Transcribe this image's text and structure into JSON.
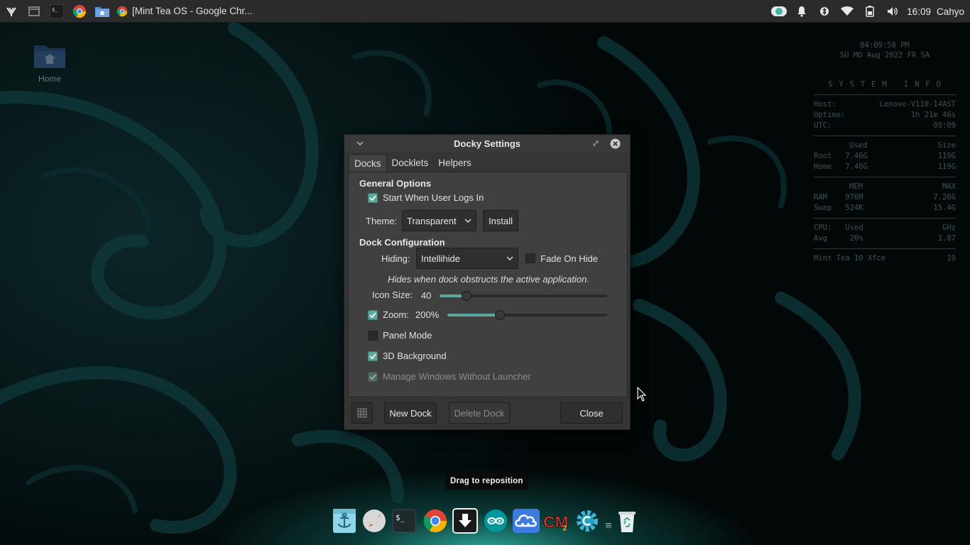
{
  "top_panel": {
    "window_title": "[Mint Tea OS - Google Chr...",
    "clock": "16:09",
    "user": "Cahyo",
    "launcher_icons": [
      "whisker-menu-icon",
      "show-desktop-icon",
      "terminal-icon",
      "chrome-icon",
      "home-folder-icon"
    ],
    "tray_icons": [
      "toggle-icon",
      "notification-bell-icon",
      "bluetooth-icon",
      "wifi-icon",
      "battery-icon",
      "volume-icon"
    ]
  },
  "desktop": {
    "home_label": "Home"
  },
  "conky": {
    "time": "04:09:58 PM",
    "calendar": "SU MO Aug 2022 FR SA",
    "heading": "S Y S T E M   I N F O",
    "host_label": "Host:",
    "host_value": "Lenovo-V110-14AST",
    "uptime_label": "Uptime:",
    "uptime_value": "1h 21m 46s",
    "utc_label": "UTC:",
    "utc_value": "09:09",
    "disk_used_hdr": "Used",
    "disk_size_hdr": "Size",
    "root_label": "Root",
    "root_used": "7.46G",
    "root_size": "119G",
    "home_label": "Home",
    "home_used": "7.46G",
    "home_size": "119G",
    "mem_hdr": "MEM",
    "max_hdr": "MAX",
    "ram_label": "RAM",
    "ram_used": "976M",
    "ram_max": "7.26G",
    "swap_label": "Swap",
    "swap_used": "524K",
    "swap_max": "15.4G",
    "cpu_label": "CPU:",
    "cpu_used_hdr": "Used",
    "cpu_ghz_hdr": "GHz",
    "avg_label": "Avg",
    "avg_used": "20%",
    "avg_ghz": "1.87",
    "footer_left": "Mint Tea 10 Xfce",
    "footer_right": "10"
  },
  "dialog": {
    "title": "Docky Settings",
    "tabs": [
      "Docks",
      "Docklets",
      "Helpers"
    ],
    "active_tab": "Docks",
    "general_options": "General Options",
    "start_when_login": "Start When User Logs In",
    "start_when_login_checked": true,
    "theme_label": "Theme:",
    "theme_value": "Transparent",
    "install_button": "Install",
    "dock_configuration": "Dock Configuration",
    "hiding_label": "Hiding:",
    "hiding_value": "Intellihide",
    "fade_on_hide": "Fade On Hide",
    "fade_on_hide_checked": false,
    "hiding_hint": "Hides when dock obstructs the active application.",
    "icon_size_label": "Icon Size:",
    "icon_size_value": "40",
    "icon_size_fraction": 0.16,
    "zoom_label": "Zoom:",
    "zoom_value": "200%",
    "zoom_checked": true,
    "zoom_fraction": 0.33,
    "panel_mode": "Panel Mode",
    "panel_mode_checked": false,
    "background_3d": "3D Background",
    "background_3d_checked": true,
    "manage_windows": "Manage Windows Without Launcher",
    "manage_windows_checked": true,
    "new_dock_button": "New Dock",
    "delete_dock_button": "Delete Dock",
    "close_button": "Close"
  },
  "tooltip": "Drag to reposition",
  "dock_items": [
    "docky-anchor-icon",
    "rocket-launcher-icon",
    "terminal-icon",
    "chrome-icon",
    "download-icon",
    "arduino-icon",
    "cloud-icon",
    "cm-app-icon",
    "settings-icon",
    "trash-icon"
  ],
  "colors": {
    "accent": "#5aa89e",
    "panel_bg": "#2b2b2b",
    "dialog_bg": "#353535"
  }
}
